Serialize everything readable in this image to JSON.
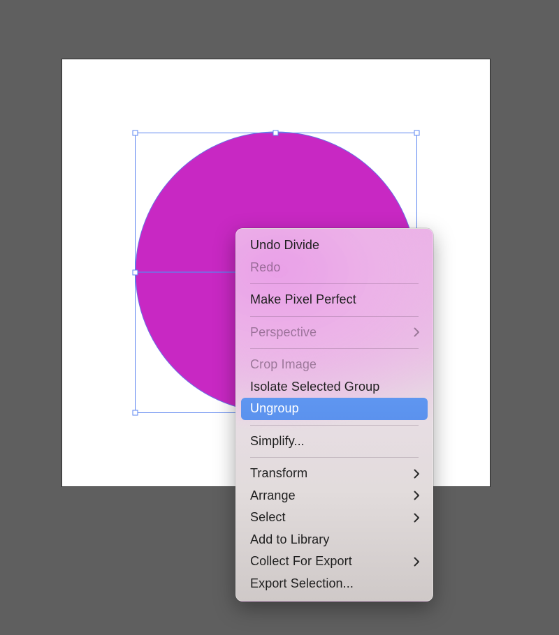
{
  "canvas": {
    "background_color": "#5f5f5f",
    "artboard_color": "#ffffff",
    "shape_fill": "#c828c3",
    "selection_color": "#5b84f0"
  },
  "context_menu": {
    "items": [
      {
        "label": "Undo Divide",
        "enabled": true
      },
      {
        "label": "Redo",
        "enabled": false
      },
      {
        "separator": true
      },
      {
        "label": "Make Pixel Perfect",
        "enabled": true
      },
      {
        "separator": true
      },
      {
        "label": "Perspective",
        "enabled": false,
        "submenu": true
      },
      {
        "separator": true
      },
      {
        "label": "Crop Image",
        "enabled": false
      },
      {
        "label": "Isolate Selected Group",
        "enabled": true
      },
      {
        "label": "Ungroup",
        "enabled": true,
        "highlighted": true
      },
      {
        "separator": true
      },
      {
        "label": "Simplify...",
        "enabled": true
      },
      {
        "separator": true
      },
      {
        "label": "Transform",
        "enabled": true,
        "submenu": true
      },
      {
        "label": "Arrange",
        "enabled": true,
        "submenu": true
      },
      {
        "label": "Select",
        "enabled": true,
        "submenu": true
      },
      {
        "label": "Add to Library",
        "enabled": true
      },
      {
        "label": "Collect For Export",
        "enabled": true,
        "submenu": true
      },
      {
        "label": "Export Selection...",
        "enabled": true
      }
    ],
    "submenu_icon": "chevron-right-icon"
  }
}
